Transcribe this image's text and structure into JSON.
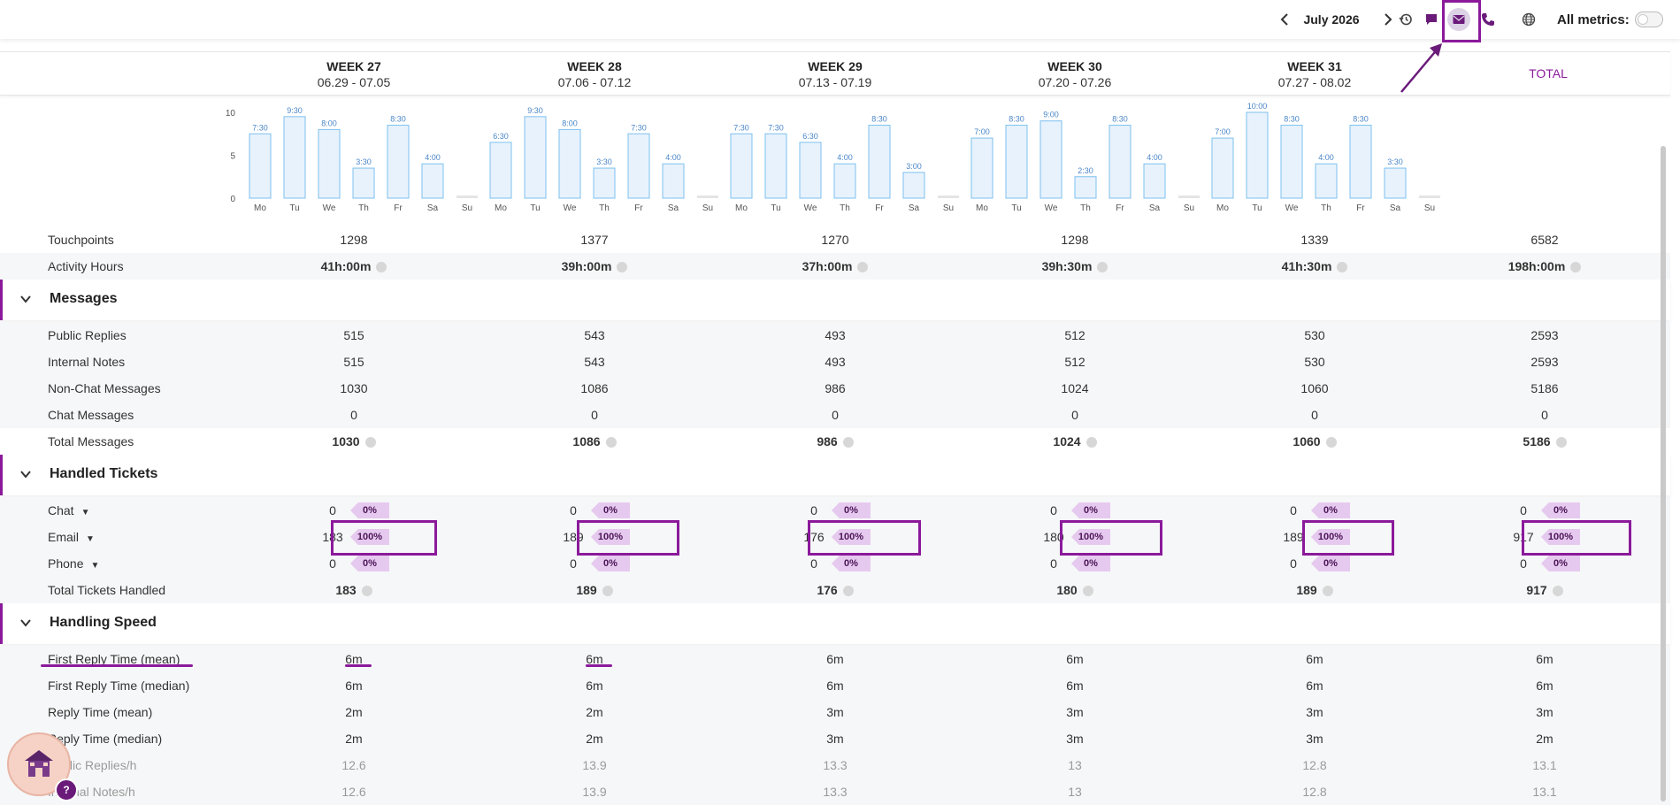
{
  "topbar": {
    "month": "July 2026",
    "all_metrics_label": "All metrics:",
    "icons": [
      "chevron-left-icon",
      "chevron-right-icon",
      "history-icon",
      "chat-icon",
      "email-icon",
      "phone-icon",
      "globe-icon"
    ]
  },
  "weeks": [
    {
      "title": "WEEK 27",
      "range": "06.29 - 07.05"
    },
    {
      "title": "WEEK 28",
      "range": "07.06 - 07.12"
    },
    {
      "title": "WEEK 29",
      "range": "07.13 - 07.19"
    },
    {
      "title": "WEEK 30",
      "range": "07.20 - 07.26"
    },
    {
      "title": "WEEK 31",
      "range": "07.27 - 08.02"
    }
  ],
  "total_label": "TOTAL",
  "chart_data": {
    "type": "bar",
    "ylim": [
      0,
      10
    ],
    "yticks": [
      "10",
      "5",
      "0"
    ],
    "days": [
      "Mo",
      "Tu",
      "We",
      "Th",
      "Fr",
      "Sa",
      "Su"
    ],
    "weeks": [
      {
        "values": [
          7.5,
          9.5,
          8,
          3.5,
          8.5,
          4,
          0
        ],
        "labels": [
          "7:30",
          "9:30",
          "8:00",
          "3:30",
          "8:30",
          "4:00",
          ""
        ]
      },
      {
        "values": [
          6.5,
          9.5,
          8,
          3.5,
          7.5,
          4,
          0
        ],
        "labels": [
          "6:30",
          "9:30",
          "8:00",
          "3:30",
          "7:30",
          "4:00",
          ""
        ]
      },
      {
        "values": [
          7.5,
          7.5,
          6.5,
          4,
          8.5,
          3,
          0
        ],
        "labels": [
          "7:30",
          "7:30",
          "6:30",
          "4:00",
          "8:30",
          "3:00",
          ""
        ]
      },
      {
        "values": [
          7,
          8.5,
          9,
          2.5,
          8.5,
          4,
          0
        ],
        "labels": [
          "7:00",
          "8:30",
          "9:00",
          "2:30",
          "8:30",
          "4:00",
          ""
        ]
      },
      {
        "values": [
          7,
          10,
          8.5,
          4,
          8.5,
          3.5,
          0
        ],
        "labels": [
          "7:00",
          "10:00",
          "8:30",
          "4:00",
          "8:30",
          "3:30",
          ""
        ]
      }
    ],
    "bar_color": "#e8f2fd",
    "bar_border": "#7cc0ef",
    "label_color": "#4a86c8"
  },
  "rows_top": [
    {
      "label": "Touchpoints",
      "values": [
        "1298",
        "1377",
        "1270",
        "1298",
        "1339",
        "6582"
      ],
      "bold": false
    },
    {
      "label": "Activity Hours",
      "values": [
        "41h:00m",
        "39h:00m",
        "37h:00m",
        "39h:30m",
        "41h:30m",
        "198h:00m"
      ],
      "bold": true
    }
  ],
  "messages": {
    "title": "Messages",
    "rows": [
      {
        "label": "Public Replies",
        "values": [
          "515",
          "543",
          "493",
          "512",
          "530",
          "2593"
        ]
      },
      {
        "label": "Internal Notes",
        "values": [
          "515",
          "543",
          "493",
          "512",
          "530",
          "2593"
        ]
      },
      {
        "label": "Non-Chat Messages",
        "values": [
          "1030",
          "1086",
          "986",
          "1024",
          "1060",
          "5186"
        ]
      },
      {
        "label": "Chat Messages",
        "values": [
          "0",
          "0",
          "0",
          "0",
          "0",
          "0"
        ]
      },
      {
        "label": "Total Messages",
        "values": [
          "1030",
          "1086",
          "986",
          "1024",
          "1060",
          "5186"
        ]
      }
    ]
  },
  "handled": {
    "title": "Handled Tickets",
    "rows": [
      {
        "label": "Chat",
        "values": [
          "0",
          "0",
          "0",
          "0",
          "0",
          "0"
        ],
        "pcts": [
          "0%",
          "0%",
          "0%",
          "0%",
          "0%",
          "0%"
        ]
      },
      {
        "label": "Email",
        "values": [
          "183",
          "189",
          "176",
          "180",
          "189",
          "917"
        ],
        "pcts": [
          "100%",
          "100%",
          "100%",
          "100%",
          "100%",
          "100%"
        ]
      },
      {
        "label": "Phone",
        "values": [
          "0",
          "0",
          "0",
          "0",
          "0",
          "0"
        ],
        "pcts": [
          "0%",
          "0%",
          "0%",
          "0%",
          "0%",
          "0%"
        ]
      }
    ],
    "total": {
      "label": "Total Tickets Handled",
      "values": [
        "183",
        "189",
        "176",
        "180",
        "189",
        "917"
      ]
    }
  },
  "speed": {
    "title": "Handling Speed",
    "rows": [
      {
        "label": "First Reply Time (mean)",
        "values": [
          "6m",
          "6m",
          "6m",
          "6m",
          "6m",
          "6m"
        ]
      },
      {
        "label": "First Reply Time (median)",
        "values": [
          "6m",
          "6m",
          "6m",
          "6m",
          "6m",
          "6m"
        ]
      },
      {
        "label": "Reply Time (mean)",
        "values": [
          "2m",
          "2m",
          "3m",
          "3m",
          "3m",
          "3m"
        ]
      },
      {
        "label": "Reply Time (median)",
        "values": [
          "2m",
          "2m",
          "3m",
          "3m",
          "3m",
          "2m"
        ]
      },
      {
        "label": "Public Replies/h",
        "values": [
          "12.6",
          "13.9",
          "13.3",
          "13",
          "12.8",
          "13.1"
        ]
      },
      {
        "label": "Internal Notes/h",
        "values": [
          "12.6",
          "13.9",
          "13.3",
          "13",
          "12.8",
          "13.1"
        ]
      }
    ]
  },
  "colors": {
    "accent": "#8b1a9b",
    "badge_bg": "#e6c9ef"
  },
  "help_label": "?"
}
